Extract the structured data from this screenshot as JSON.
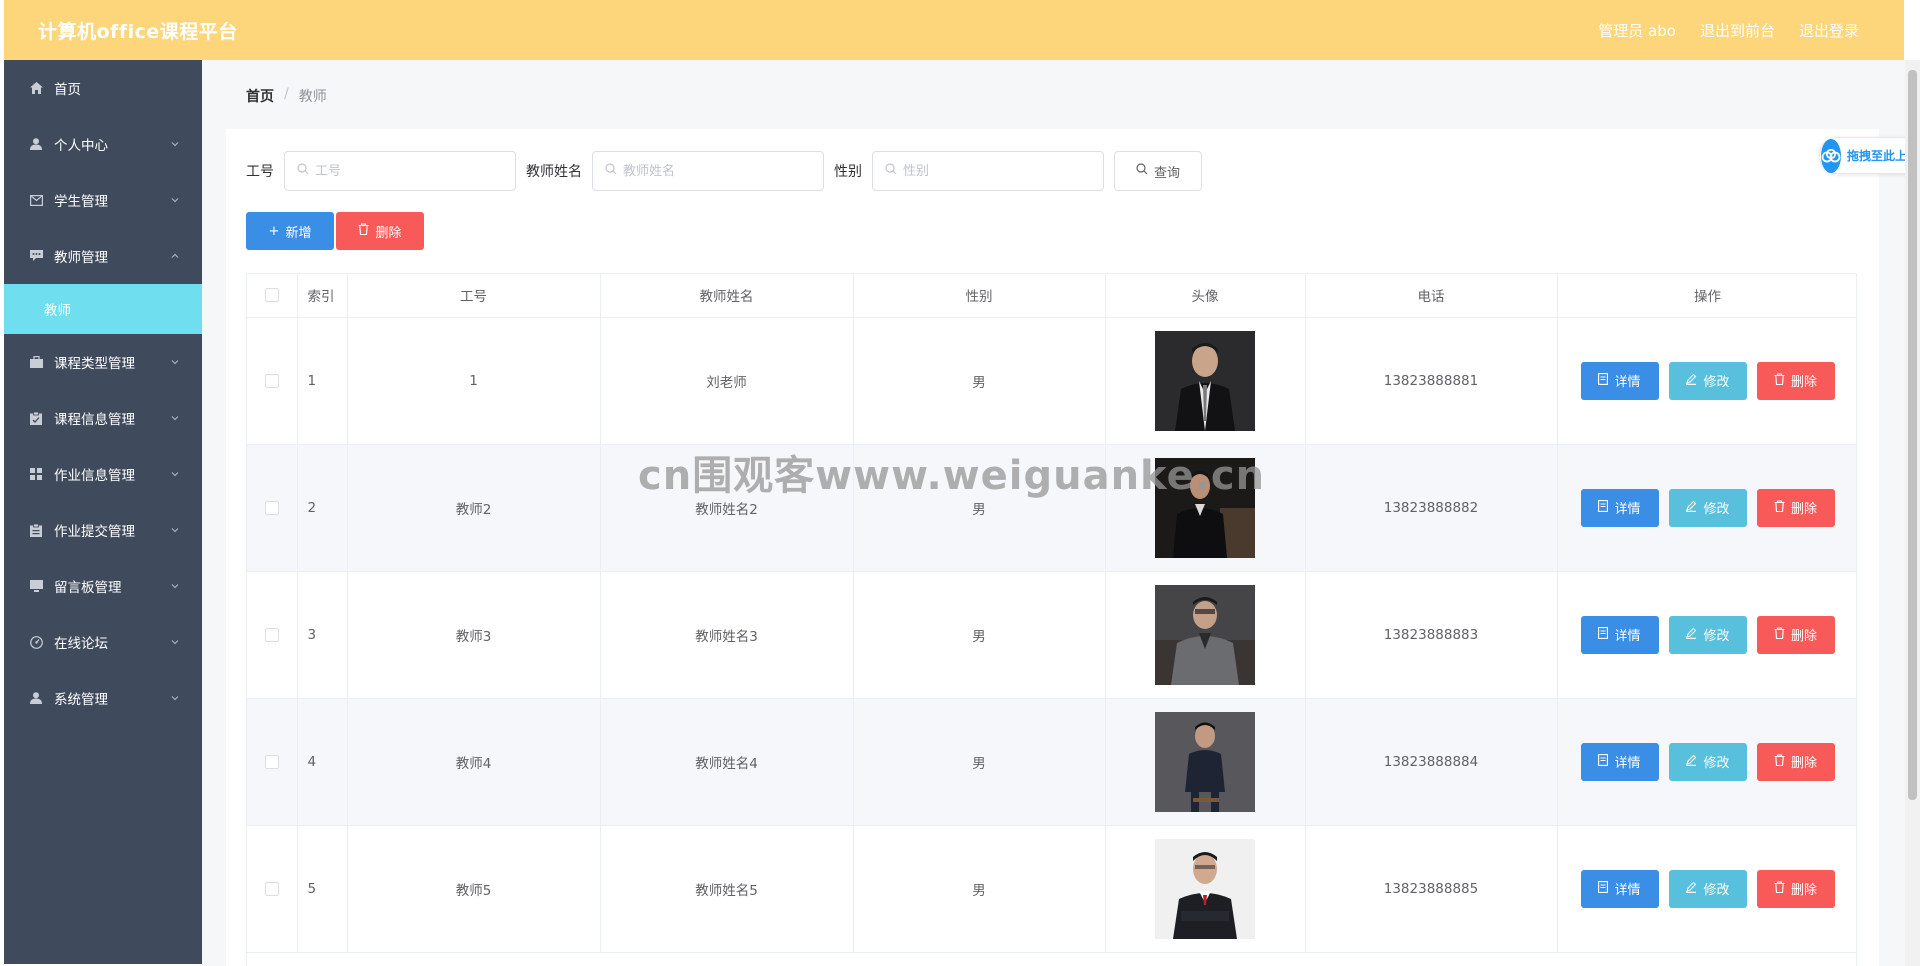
{
  "header": {
    "title": "计算机office课程平台",
    "admin_label": "管理员 abo",
    "to_front": "退出到前台",
    "logout": "退出登录"
  },
  "sidebar": {
    "items": [
      {
        "label": "首页",
        "icon": "home-icon"
      },
      {
        "label": "个人中心",
        "icon": "user-icon"
      },
      {
        "label": "学生管理",
        "icon": "mail-icon"
      },
      {
        "label": "教师管理",
        "icon": "chat-icon",
        "expanded": true
      },
      {
        "label": "教师",
        "active": true
      },
      {
        "label": "课程类型管理",
        "icon": "briefcase-icon"
      },
      {
        "label": "课程信息管理",
        "icon": "clipboard-icon"
      },
      {
        "label": "作业信息管理",
        "icon": "grid-icon"
      },
      {
        "label": "作业提交管理",
        "icon": "document-icon"
      },
      {
        "label": "留言板管理",
        "icon": "monitor-icon"
      },
      {
        "label": "在线论坛",
        "icon": "gauge-icon"
      },
      {
        "label": "系统管理",
        "icon": "user-icon"
      }
    ],
    "active_color": "#6fdff0"
  },
  "breadcrumb": {
    "home": "首页",
    "separator": "/",
    "current": "教师"
  },
  "search": {
    "label_id": "工号",
    "placeholder_id": "工号",
    "label_name": "教师姓名",
    "placeholder_name": "教师姓名",
    "label_gender": "性别",
    "placeholder_gender": "性别",
    "query": "查询"
  },
  "actions": {
    "add": "新增",
    "delete": "删除"
  },
  "table": {
    "headers": {
      "index": "索引",
      "id": "工号",
      "name": "教师姓名",
      "gender": "性别",
      "avatar": "头像",
      "phone": "电话",
      "ops": "操作"
    },
    "rows": [
      {
        "index": "1",
        "id": "1",
        "name": "刘老师",
        "gender": "男",
        "phone": "13823888881"
      },
      {
        "index": "2",
        "id": "教师2",
        "name": "教师姓名2",
        "gender": "男",
        "phone": "13823888882"
      },
      {
        "index": "3",
        "id": "教师3",
        "name": "教师姓名3",
        "gender": "男",
        "phone": "13823888883"
      },
      {
        "index": "4",
        "id": "教师4",
        "name": "教师姓名4",
        "gender": "男",
        "phone": "13823888884"
      },
      {
        "index": "5",
        "id": "教师5",
        "name": "教师姓名5",
        "gender": "男",
        "phone": "13823888885"
      }
    ],
    "op_labels": {
      "detail": "详情",
      "edit": "修改",
      "delete": "删除"
    }
  },
  "watermark": "cn围观客www.weiguanke.cn",
  "drag_widget": "拖拽至此上传",
  "colors": {
    "header_bg": "#fdd57a",
    "sidebar_bg": "#404a5d",
    "primary": "#3a8ee6",
    "info": "#58c0dd",
    "danger": "#f85a5a"
  }
}
